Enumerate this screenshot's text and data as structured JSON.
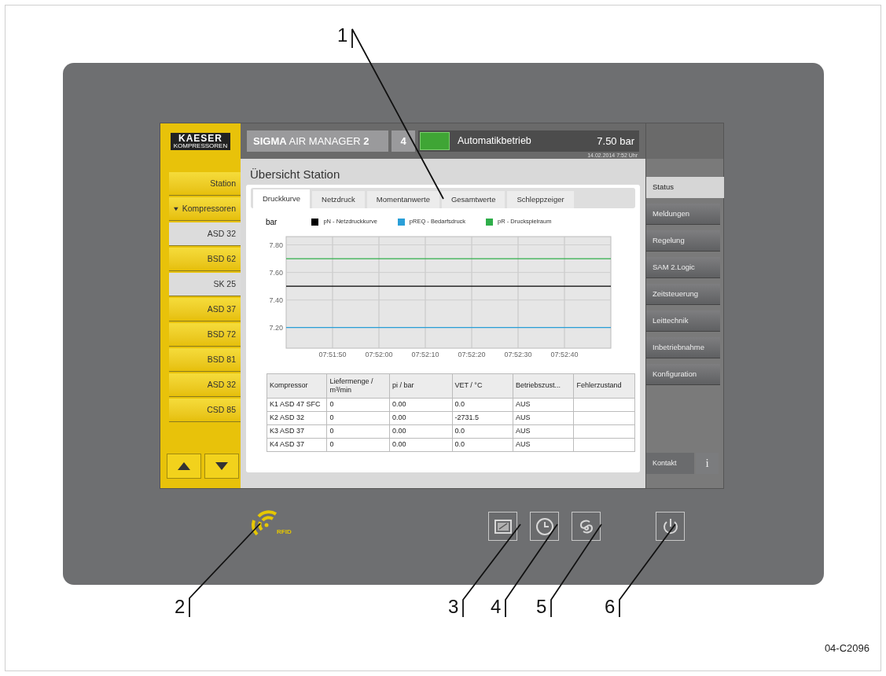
{
  "logo": {
    "name": "KAESER",
    "subtitle": "KOMPRESSOREN"
  },
  "header": {
    "title": "**SIGMA** AIR MANAGER **2**",
    "count": "4",
    "mode": "Automatikbetrieb",
    "pressure": "7.50 bar",
    "timestamp": "14.02.2014 7:52 Uhr"
  },
  "sidebar": {
    "items": [
      {
        "kind": "nav",
        "label": "Station",
        "greyed": false
      },
      {
        "kind": "group",
        "label": "Kompressoren",
        "expanded": true,
        "greyed": false
      },
      {
        "kind": "compressor",
        "label": "ASD 32",
        "greyed": true
      },
      {
        "kind": "compressor",
        "label": "BSD 62",
        "greyed": false
      },
      {
        "kind": "compressor",
        "label": "SK 25",
        "greyed": true
      },
      {
        "kind": "compressor",
        "label": "ASD 37",
        "greyed": false
      },
      {
        "kind": "compressor",
        "label": "BSD 72",
        "greyed": false
      },
      {
        "kind": "compressor",
        "label": "BSD 81",
        "greyed": false
      },
      {
        "kind": "compressor",
        "label": "ASD 32",
        "greyed": false
      },
      {
        "kind": "compressor",
        "label": "CSD 85",
        "greyed": false
      }
    ]
  },
  "page_title": "Übersicht Station",
  "tabs": [
    {
      "label": "Druckkurve",
      "selected": true
    },
    {
      "label": "Netzdruck",
      "selected": false
    },
    {
      "label": "Momentanwerte",
      "selected": false
    },
    {
      "label": "Gesamtwerte",
      "selected": false
    },
    {
      "label": "Schleppzeiger",
      "selected": false
    }
  ],
  "chart": {
    "chart_data": {
      "type": "line",
      "ylabel": "bar",
      "categories": [
        null,
        "07:51:50",
        "07:52:00",
        "07:52:10",
        "07:52:20",
        "07:52:30",
        "07:52:40",
        null
      ],
      "ylim": [
        7.05,
        7.86
      ],
      "grid": true,
      "legend": "top",
      "yticks": [
        {
          "value": 7.8,
          "label": "7.80"
        },
        {
          "value": 7.6,
          "label": "7.60"
        },
        {
          "value": 7.4,
          "label": "7.40"
        },
        {
          "value": 7.2,
          "label": "7.20"
        }
      ],
      "series": [
        {
          "name": "pN - Netzdruckkurve",
          "color": "#000000",
          "values": [
            7.5,
            7.5,
            7.5,
            7.5,
            7.5,
            7.5,
            7.5,
            7.5
          ]
        },
        {
          "name": "pREQ - Bedarfsdruck",
          "color": "#2a9fd8",
          "values": [
            7.2,
            7.2,
            7.2,
            7.2,
            7.2,
            7.2,
            7.2,
            7.2
          ]
        },
        {
          "name": "pR - Druckspielraum",
          "color": "#2fae4a",
          "values": [
            7.7,
            7.7,
            7.7,
            7.7,
            7.7,
            7.7,
            7.7,
            7.7
          ]
        }
      ]
    }
  },
  "table": {
    "columns": [
      "Kompressor",
      "Liefermenge / m³/min",
      "pi / bar",
      "VET / °C",
      "Betriebszust...",
      "Fehlerzustand"
    ],
    "rows": [
      [
        "K1 ASD 47 SFC",
        "0",
        "0.00",
        "0.0",
        "AUS",
        ""
      ],
      [
        "K2 ASD 32",
        "0",
        "0.00",
        "-2731.5",
        "AUS",
        ""
      ],
      [
        "K3 ASD 37",
        "0",
        "0.00",
        "0.0",
        "AUS",
        ""
      ],
      [
        "K4 ASD 37",
        "0",
        "0.00",
        "0.0",
        "AUS",
        ""
      ]
    ]
  },
  "right_nav": [
    {
      "label": "Status",
      "selected": true
    },
    {
      "label": "Meldungen",
      "selected": false
    },
    {
      "label": "Regelung",
      "selected": false
    },
    {
      "label": "SAM 2.Logic",
      "selected": false
    },
    {
      "label": "Zeitsteuerung",
      "selected": false
    },
    {
      "label": "Leittechnik",
      "selected": false
    },
    {
      "label": "Inbetriebnahme",
      "selected": false
    },
    {
      "label": "Konfiguration",
      "selected": false
    }
  ],
  "contact": {
    "label": "Kontakt",
    "info": "i"
  },
  "rfid_label": "RFID",
  "panel_buttons": [
    {
      "kind": "display"
    },
    {
      "kind": "clock"
    },
    {
      "kind": "swirl"
    },
    {
      "kind": "power"
    }
  ],
  "callouts": [
    "1",
    "2",
    "3",
    "4",
    "5",
    "6"
  ],
  "figure_code": "04-C2096"
}
